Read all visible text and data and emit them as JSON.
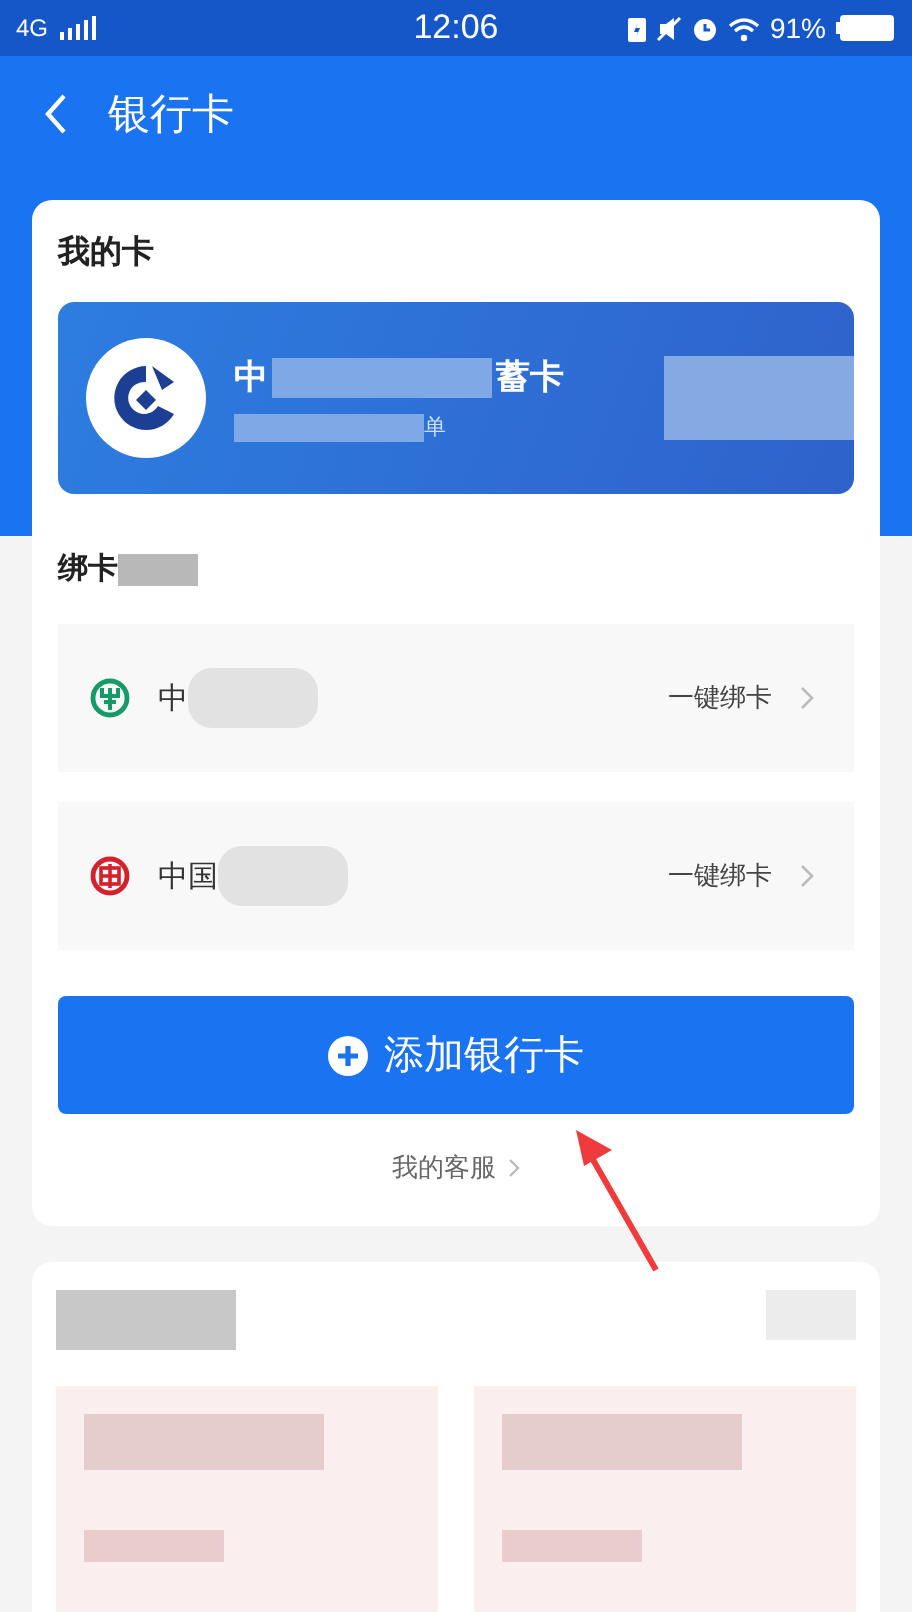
{
  "status_bar": {
    "network": "4G",
    "time": "12:06",
    "battery": "91%"
  },
  "header": {
    "title": "银行卡"
  },
  "my_cards": {
    "title": "我的卡",
    "card": {
      "name_start": "中",
      "name_end": "蓄卡",
      "subtitle_end": "单"
    }
  },
  "bind_cards": {
    "title": "绑卡",
    "banks": [
      {
        "kind": "green",
        "name": "中",
        "action": "一键绑卡"
      },
      {
        "kind": "red",
        "name": "中国",
        "action": "一键绑卡"
      }
    ]
  },
  "add_button": {
    "label": "添加银行卡"
  },
  "service_link": {
    "label": "我的客服"
  }
}
